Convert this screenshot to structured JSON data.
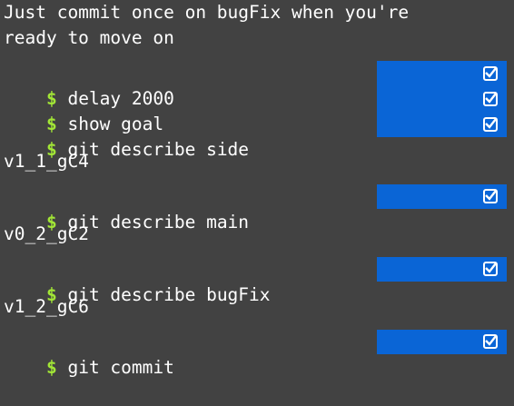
{
  "message": {
    "line1": "Just commit once on bugFix when you're",
    "line2": "ready to move on"
  },
  "prompt_symbol": "$",
  "commands": [
    {
      "text": " delay 2000",
      "done": true
    },
    {
      "text": " show goal",
      "done": true
    },
    {
      "text": " git describe side",
      "done": true
    },
    {
      "text": " git describe main",
      "done": true
    },
    {
      "text": " git describe bugFix",
      "done": true
    },
    {
      "text": " git commit",
      "done": true
    }
  ],
  "outputs": [
    "v1_1_gC4",
    "v0_2_gC2",
    "v1_2_gC6"
  ],
  "colors": {
    "background": "#424242",
    "prompt": "#a2e636",
    "status_bar": "#0a65d6",
    "text": "#ffffff"
  },
  "icons": {
    "status": "checkbox-checked-icon"
  }
}
